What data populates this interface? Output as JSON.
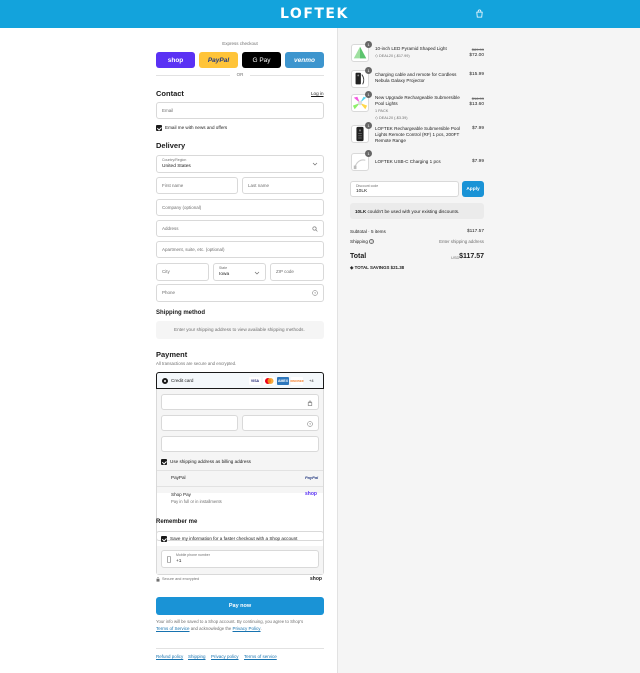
{
  "header": {
    "logo": "LOFTEK",
    "cart_icon": "bag-icon"
  },
  "express": {
    "title": "Express checkout",
    "buttons": {
      "shop": "shop",
      "paypal": "PayPal",
      "gpay": "G Pay",
      "venmo": "venmo"
    },
    "or_label": "OR"
  },
  "contact": {
    "heading": "Contact",
    "login_link": "Log in",
    "email_placeholder": "Email",
    "news_label": "Email me with news and offers"
  },
  "delivery": {
    "heading": "Delivery",
    "country_label": "Country/Region",
    "country_value": "United States",
    "first_name": "First name",
    "last_name": "Last name",
    "company": "Company (optional)",
    "address": "Address",
    "apartment": "Apartment, suite, etc. (optional)",
    "city": "City",
    "state_label": "State",
    "state_value": "Iowa",
    "zip": "ZIP code",
    "phone": "Phone"
  },
  "shipping": {
    "heading": "Shipping method",
    "notice": "Enter your shipping address to view available shipping methods."
  },
  "payment": {
    "heading": "Payment",
    "sub": "All transactions are secure and encrypted.",
    "credit_card": "Credit card",
    "more_cards": "+4",
    "card_brands": [
      "VISA",
      "MC",
      "AMEX",
      "DISCOVER"
    ],
    "billing_label": "Use shipping address as billing address",
    "paypal": "PayPal",
    "paypal_logo": "PayPal",
    "shoppay": "Shop Pay",
    "shoppay_sub": "Pay in full or in installments",
    "shoppay_logo": "shop"
  },
  "remember": {
    "heading": "Remember me",
    "save_label": "Save my information for a faster checkout with a Shop account",
    "phone_label": "Mobile phone number",
    "phone_value": "+1",
    "secure": "Secure and encrypted",
    "shop_logo": "shop"
  },
  "pay_now": "Pay now",
  "consent": {
    "text1": "Your info will be saved to a Shop account. By continuing, you agree to Shop's",
    "tos": "Terms of Service",
    "and": " and acknowledge the ",
    "privacy": "Privacy Policy",
    "end": "."
  },
  "footer": [
    "Refund policy",
    "Shipping",
    "Privacy policy",
    "Terms of service"
  ],
  "cart": {
    "items": [
      {
        "qty": "1",
        "name": "10-inch LED Pyramid Shaped Light",
        "discount": "DEAL20 (-$17.99)",
        "old_price": "$89.99",
        "price": "$72.00"
      },
      {
        "qty": "1",
        "name": "Charging cable and remote for Cordless Nebula Galaxy Projector",
        "discount": "",
        "old_price": "",
        "price": "$15.99"
      },
      {
        "qty": "1",
        "name": "New Upgrade Rechargeable Submersible Pool Lights",
        "variant": "1 PACK",
        "discount": "DEAL20 (-$3.39)",
        "old_price": "$16.99",
        "price": "$13.60"
      },
      {
        "qty": "1",
        "name": "LOFTEK Rechargeable Submersible Pool Lights Remote Control (RF) 1 pcs, 200FT Remote Range",
        "discount": "",
        "old_price": "",
        "price": "$7.99"
      },
      {
        "qty": "1",
        "name": "LOFTEK USB-C Charging 1 pcs",
        "discount": "",
        "old_price": "",
        "price": "$7.99"
      }
    ],
    "discount_label": "Discount code",
    "discount_value": "10LK",
    "apply": "Apply",
    "discount_error_code": "10LK",
    "discount_error": " couldn't be used with your existing discounts.",
    "subtotal_label": "Subtotal · 5 items",
    "subtotal": "$117.57",
    "shipping_label": "Shipping",
    "shipping_value": "Enter shipping address",
    "total_label": "Total",
    "currency": "USD",
    "total": "$117.57",
    "savings_label": "TOTAL SAVINGS",
    "savings": "$21.38"
  }
}
